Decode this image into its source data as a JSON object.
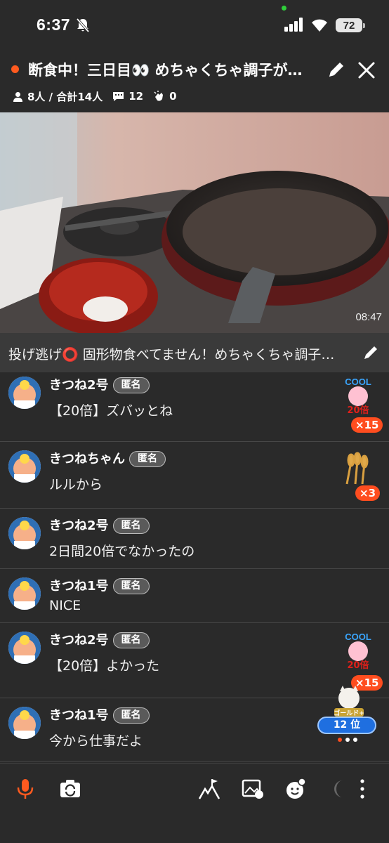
{
  "status": {
    "time": "6:37",
    "battery": "72",
    "icons": [
      "bell-off-icon",
      "signal-icon",
      "wifi-icon",
      "battery-icon"
    ]
  },
  "header": {
    "title": "断食中！三日目👀 めちゃくちゃ調子が…",
    "listeners": "8人 / 合計14人",
    "comments_count": "12",
    "claps": "0",
    "live_dot_color": "#ff5a1f"
  },
  "video": {
    "elapsed": "08:47"
  },
  "caption": {
    "text": "投げ逃げ⭕️ 固形物食べてません！めちゃくちゃ調子…"
  },
  "comments": [
    {
      "name": "きつね2号",
      "badge": "匿名",
      "text": "【20倍】ズバッとね",
      "gift": "cool-20x-gift-icon",
      "gift_count": "×15"
    },
    {
      "name": "きつねちゃん",
      "badge": "匿名",
      "text": "ルルから",
      "gift": "wheat-gift-icon",
      "gift_count": "×3"
    },
    {
      "name": "きつね2号",
      "badge": "匿名",
      "text": "2日間20倍でなかったの",
      "gift": "",
      "gift_count": ""
    },
    {
      "name": "きつね1号",
      "badge": "匿名",
      "text": "NICE",
      "gift": "",
      "gift_count": ""
    },
    {
      "name": "きつね2号",
      "badge": "匿名",
      "text": "【20倍】よかった",
      "gift": "cool-20x-gift-icon",
      "gift_count": "×15"
    },
    {
      "name": "きつね1号",
      "badge": "匿名",
      "text": "今から仕事だよ",
      "gift": "",
      "gift_count": ""
    }
  ],
  "gift_labels": {
    "cool": "COOL",
    "multiplier": "20倍"
  },
  "rank": {
    "label": "ゴールド+",
    "position": "12 位"
  },
  "toolbar": {
    "icons": [
      "mic-icon",
      "camera-switch-icon",
      "flag-icon",
      "image-icon",
      "emoji-icon",
      "moon-icon",
      "more-icon"
    ],
    "accent": "#ff5a1f"
  }
}
